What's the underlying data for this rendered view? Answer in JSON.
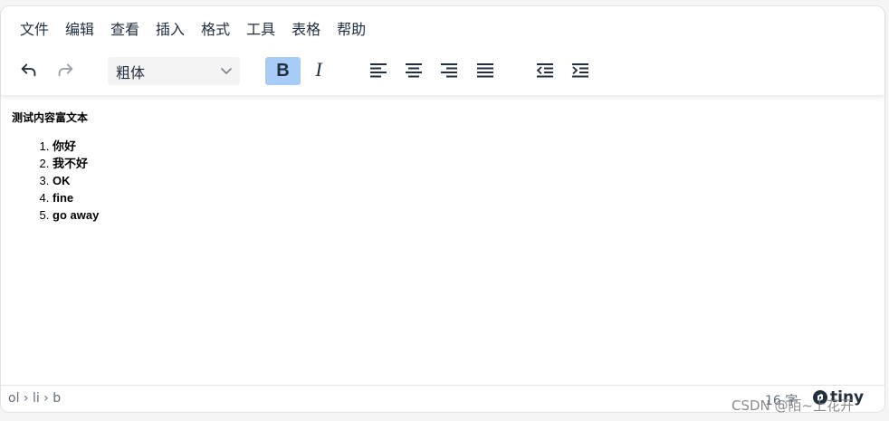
{
  "menubar": {
    "items": [
      "文件",
      "编辑",
      "查看",
      "插入",
      "格式",
      "工具",
      "表格",
      "帮助"
    ]
  },
  "toolbar": {
    "font_select_value": "粗体",
    "icons": {
      "undo": "undo-icon",
      "redo": "redo-icon",
      "bold": "bold-icon",
      "italic": "italic-icon",
      "align_left": "align-left-icon",
      "align_center": "align-center-icon",
      "align_right": "align-right-icon",
      "justify": "justify-icon",
      "outdent": "outdent-icon",
      "indent": "indent-icon"
    },
    "bold_label": "B",
    "italic_label": "I",
    "active_color": "#a6ccf7"
  },
  "content": {
    "heading": "测试内容富文本",
    "list_items": [
      "你好",
      "我不好",
      "OK",
      "fine",
      "go away"
    ]
  },
  "statusbar": {
    "path": "ol › li › b",
    "word_count": "16 字",
    "brand": "tiny"
  },
  "watermark": "CSDN @陌~上花开"
}
